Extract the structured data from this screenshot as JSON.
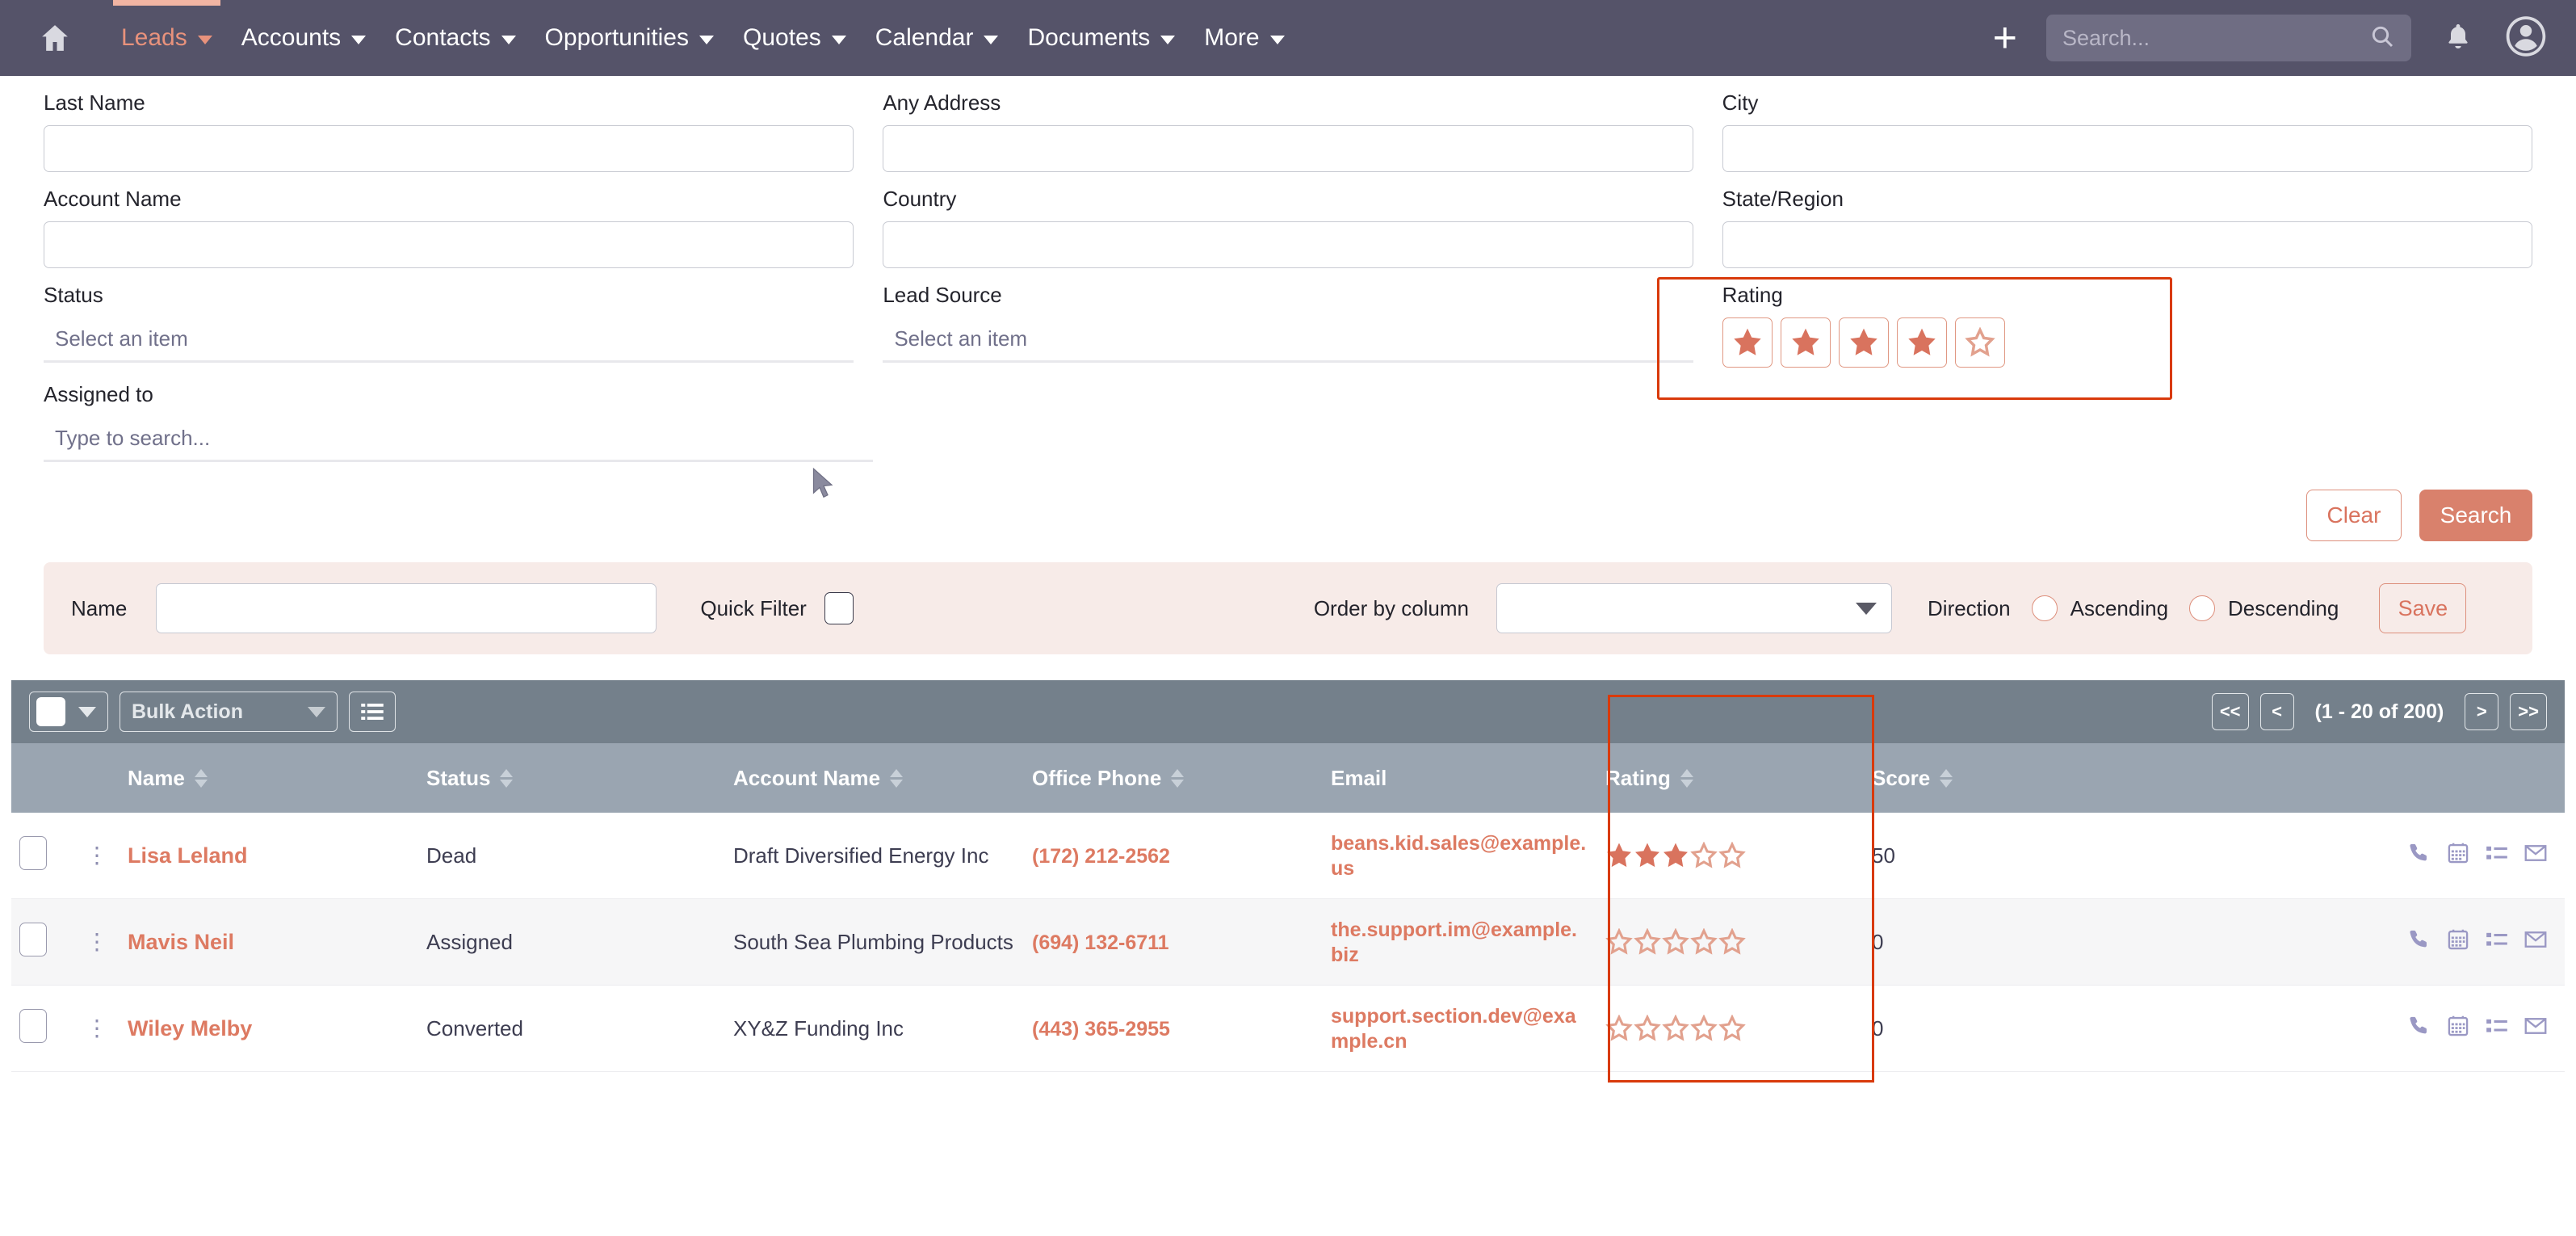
{
  "navbar": {
    "home_icon": "home-icon",
    "items": [
      {
        "label": "Leads",
        "active": true
      },
      {
        "label": "Accounts",
        "active": false
      },
      {
        "label": "Contacts",
        "active": false
      },
      {
        "label": "Opportunities",
        "active": false
      },
      {
        "label": "Quotes",
        "active": false
      },
      {
        "label": "Calendar",
        "active": false
      },
      {
        "label": "Documents",
        "active": false
      },
      {
        "label": "More",
        "active": false
      }
    ],
    "plus_label": "+",
    "search_placeholder": "Search...",
    "search_value": "",
    "bell_icon": "bell-icon",
    "avatar_icon": "user-avatar-icon"
  },
  "search_form": {
    "fields": {
      "last_name": {
        "label": "Last Name",
        "value": ""
      },
      "any_address": {
        "label": "Any Address",
        "value": ""
      },
      "city": {
        "label": "City",
        "value": ""
      },
      "account_name": {
        "label": "Account Name",
        "value": ""
      },
      "country": {
        "label": "Country",
        "value": ""
      },
      "state_region": {
        "label": "State/Region",
        "value": ""
      },
      "status": {
        "label": "Status",
        "placeholder": "Select an item",
        "value": ""
      },
      "lead_source": {
        "label": "Lead Source",
        "placeholder": "Select an item",
        "value": ""
      },
      "rating": {
        "label": "Rating",
        "value": 4,
        "max": 5
      },
      "assigned_to": {
        "label": "Assigned to",
        "placeholder": "Type to search...",
        "value": ""
      }
    },
    "clear_label": "Clear",
    "search_label": "Search"
  },
  "filter_bar": {
    "name_label": "Name",
    "name_value": "",
    "quick_filter_label": "Quick Filter",
    "quick_filter_checked": false,
    "order_by_label": "Order by column",
    "order_by_value": "",
    "direction_label": "Direction",
    "ascending_label": "Ascending",
    "descending_label": "Descending",
    "direction_selected": "",
    "save_label": "Save"
  },
  "table_toolbar": {
    "select_all_checked": false,
    "bulk_action_label": "Bulk Action",
    "column_chooser_icon": "list-icon",
    "pager": {
      "first_label": "<<",
      "prev_label": "<",
      "count_label": "(1 - 20 of 200)",
      "next_label": ">",
      "last_label": ">>"
    }
  },
  "table": {
    "columns": [
      {
        "label": "Name",
        "sortable": true
      },
      {
        "label": "Status",
        "sortable": true
      },
      {
        "label": "Account Name",
        "sortable": true
      },
      {
        "label": "Office Phone",
        "sortable": true
      },
      {
        "label": "Email",
        "sortable": false
      },
      {
        "label": "Rating",
        "sortable": true
      },
      {
        "label": "Score",
        "sortable": true
      }
    ],
    "rows": [
      {
        "name": "Lisa Leland",
        "status": "Dead",
        "account_name": "Draft Diversified Energy Inc",
        "office_phone": "(172) 212-2562",
        "email": "beans.kid.sales@example.us",
        "rating": 3,
        "score": "50"
      },
      {
        "name": "Mavis Neil",
        "status": "Assigned",
        "account_name": "South Sea Plumbing Products",
        "office_phone": "(694) 132-6711",
        "email": "the.support.im@example.biz",
        "rating": 0,
        "score": "0"
      },
      {
        "name": "Wiley Melby",
        "status": "Converted",
        "account_name": "XY&Z Funding Inc",
        "office_phone": "(443) 365-2955",
        "email": "support.section.dev@example.cn",
        "rating": 0,
        "score": "0"
      }
    ],
    "row_action_icons": [
      "phone-icon",
      "calendar-icon",
      "task-list-icon",
      "envelope-icon"
    ]
  },
  "colors": {
    "navbar_bg": "#555369",
    "accent": "#d9735e",
    "highlight_box": "#d93a0b",
    "filter_bar_bg": "#f7ebe8",
    "table_toolbar_bg": "#74808b",
    "table_header_bg": "#9aa5b1"
  }
}
